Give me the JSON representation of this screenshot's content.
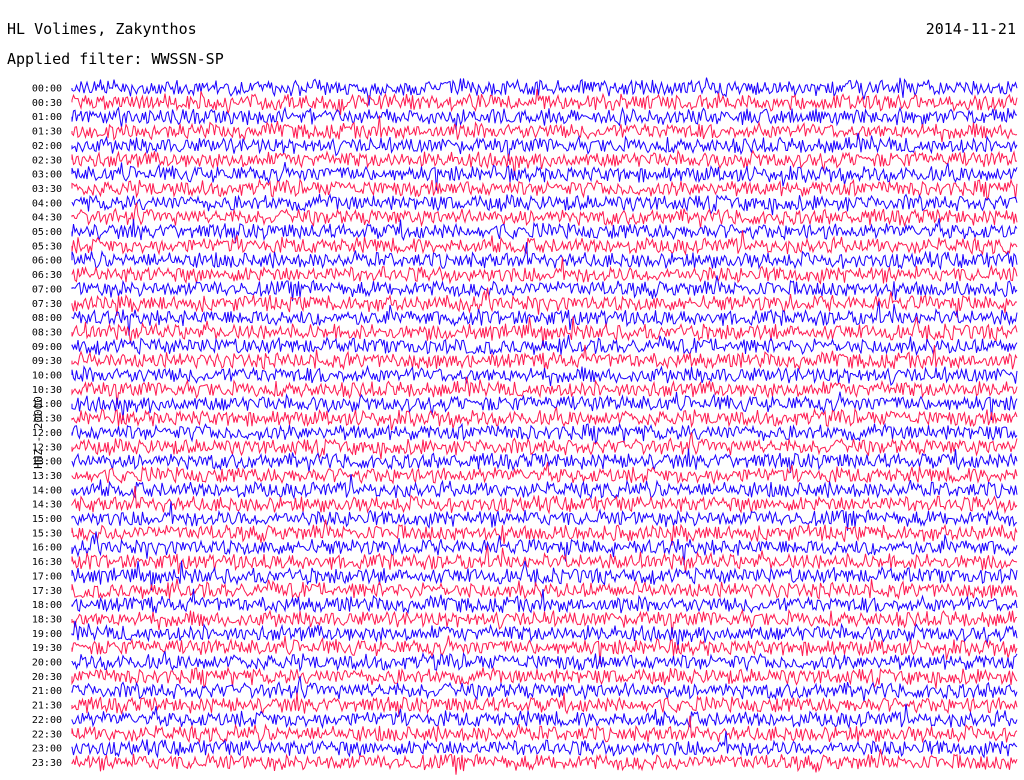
{
  "header": {
    "station": "HL Volimes, Zakynthos",
    "filter": "Applied filter: WWSSN-SP",
    "date": "2014-11-21"
  },
  "axis": {
    "ylabel": "HHZ - 20000"
  },
  "colors": {
    "trace_a": "#1a00ff",
    "trace_b": "#ff1a50",
    "background": "#ffffff"
  },
  "chart_data": {
    "type": "line",
    "title": "HL Volimes, Zakynthos",
    "subtitle": "Applied filter: WWSSN-SP",
    "ylabel": "HHZ - 20000",
    "xlabel": "",
    "row_labels": [
      "00:00",
      "00:30",
      "01:00",
      "01:30",
      "02:00",
      "02:30",
      "03:00",
      "03:30",
      "04:00",
      "04:30",
      "05:00",
      "05:30",
      "06:00",
      "06:30",
      "07:00",
      "07:30",
      "08:00",
      "08:30",
      "09:00",
      "09:30",
      "10:00",
      "10:30",
      "11:00",
      "11:30",
      "12:00",
      "12:30",
      "13:00",
      "13:30",
      "14:00",
      "14:30",
      "15:00",
      "15:30",
      "16:00",
      "16:30",
      "17:00",
      "17:30",
      "18:00",
      "18:30",
      "19:00",
      "19:30",
      "20:00",
      "20:30",
      "21:00",
      "21:30",
      "22:00",
      "22:30",
      "23:00",
      "23:30"
    ],
    "row_minutes": 30,
    "series_colors": [
      "#1a00ff",
      "#ff1a50"
    ],
    "grid": false
  }
}
